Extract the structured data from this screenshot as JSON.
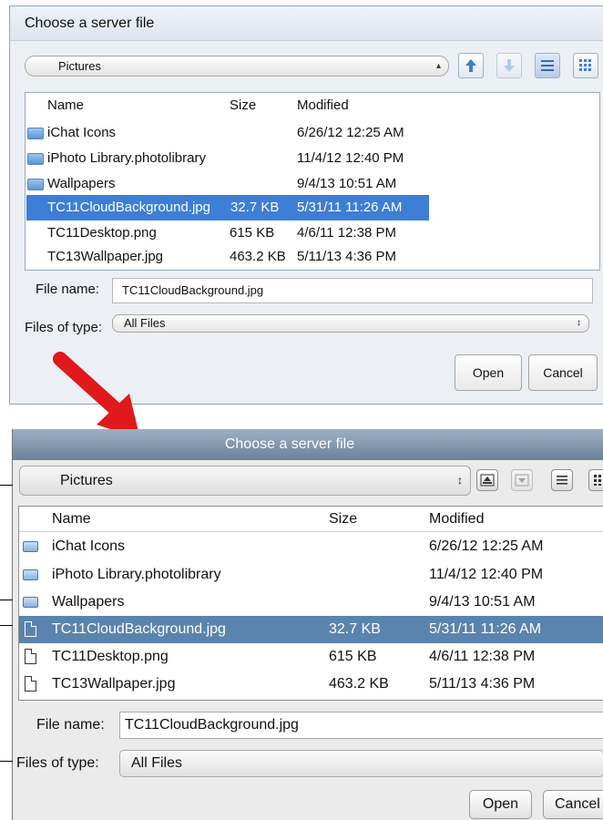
{
  "old_dialog": {
    "title": "Choose a server file",
    "folder": "Pictures",
    "columns": {
      "name": "Name",
      "size": "Size",
      "modified": "Modified"
    },
    "files": [
      {
        "name": "iChat Icons",
        "size": "",
        "modified": "6/26/12 12:25 AM",
        "kind": "folder"
      },
      {
        "name": "iPhoto Library.photolibrary",
        "size": "",
        "modified": "11/4/12 12:40 PM",
        "kind": "folder"
      },
      {
        "name": "Wallpapers",
        "size": "",
        "modified": "9/4/13 10:51 AM",
        "kind": "folder"
      },
      {
        "name": "TC11CloudBackground.jpg",
        "size": "32.7 KB",
        "modified": "5/31/11 11:26 AM",
        "kind": "file",
        "selected": true
      },
      {
        "name": "TC11Desktop.png",
        "size": "615 KB",
        "modified": "4/6/11 12:38 PM",
        "kind": "file"
      },
      {
        "name": "TC13Wallpaper.jpg",
        "size": "463.2 KB",
        "modified": "5/11/13 4:36 PM",
        "kind": "file"
      }
    ],
    "file_name_label": "File name:",
    "file_name_value": "TC11CloudBackground.jpg",
    "files_of_type_label": "Files of type:",
    "files_of_type_value": "All Files",
    "open_label": "Open",
    "cancel_label": "Cancel"
  },
  "new_dialog": {
    "title": "Choose a server file",
    "folder": "Pictures",
    "columns": {
      "name": "Name",
      "size": "Size",
      "modified": "Modified"
    },
    "files": [
      {
        "name": "iChat Icons",
        "size": "",
        "modified": "6/26/12 12:25 AM",
        "kind": "folder"
      },
      {
        "name": "iPhoto Library.photolibrary",
        "size": "",
        "modified": "11/4/12 12:40 PM",
        "kind": "folder"
      },
      {
        "name": "Wallpapers",
        "size": "",
        "modified": "9/4/13 10:51 AM",
        "kind": "folder"
      },
      {
        "name": "TC11CloudBackground.jpg",
        "size": "32.7 KB",
        "modified": "5/31/11 11:26 AM",
        "kind": "file",
        "selected": true
      },
      {
        "name": "TC11Desktop.png",
        "size": "615 KB",
        "modified": "4/6/11 12:38 PM",
        "kind": "file"
      },
      {
        "name": "TC13Wallpaper.jpg",
        "size": "463.2 KB",
        "modified": "5/11/13 4:36 PM",
        "kind": "file"
      }
    ],
    "file_name_label": "File name:",
    "file_name_value": "TC11CloudBackground.jpg",
    "files_of_type_label": "Files of type:",
    "files_of_type_value": "All Files",
    "open_label": "Open",
    "cancel_label": "Cancel"
  },
  "icons": {
    "up": "arrow-up-icon",
    "down": "arrow-down-icon",
    "list_view": "list-view-icon",
    "grid_view": "grid-view-icon",
    "folder": "folder-icon",
    "file": "document-icon",
    "pointer": "red-arrow-icon"
  },
  "colors": {
    "old_selection": "#3d7ed6",
    "new_selection": "#5a84ad",
    "new_titlebar": "#7d91a8",
    "arrow": "#e0191b"
  }
}
